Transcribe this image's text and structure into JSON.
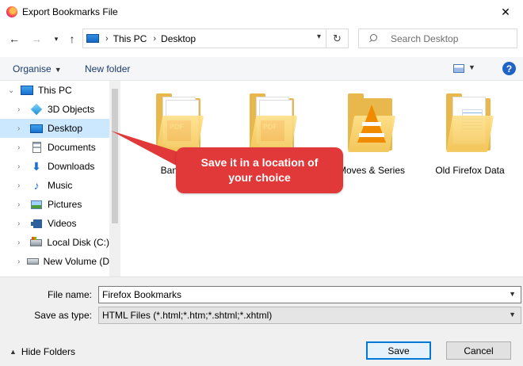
{
  "window": {
    "title": "Export Bookmarks File",
    "close_glyph": "✕"
  },
  "address_bar": {
    "breadcrumb": [
      "This PC",
      "Desktop"
    ],
    "search_placeholder": "Search Desktop"
  },
  "toolbar": {
    "organise_label": "Organise",
    "new_folder_label": "New folder",
    "help_glyph": "?"
  },
  "sidebar": {
    "items": [
      {
        "label": "This PC",
        "icon": "pc-icon"
      },
      {
        "label": "3D Objects",
        "icon": "3d-objects-icon"
      },
      {
        "label": "Desktop",
        "icon": "desktop-icon",
        "selected": true
      },
      {
        "label": "Documents",
        "icon": "documents-icon"
      },
      {
        "label": "Downloads",
        "icon": "downloads-icon"
      },
      {
        "label": "Music",
        "icon": "music-icon"
      },
      {
        "label": "Pictures",
        "icon": "pictures-icon"
      },
      {
        "label": "Videos",
        "icon": "videos-icon"
      },
      {
        "label": "Local Disk (C:)",
        "icon": "local-disk-icon"
      },
      {
        "label": "New Volume (D",
        "icon": "volume-icon"
      }
    ]
  },
  "files": [
    {
      "label": "Bank Sta",
      "kind": "pdf-folder"
    },
    {
      "label": "",
      "kind": "pdf-folder"
    },
    {
      "label": "Moves & Series",
      "kind": "vlc-folder"
    },
    {
      "label": "Old Firefox Data",
      "kind": "doc-folder"
    }
  ],
  "callout": {
    "line1": "Save it in a location of",
    "line2": "your choice",
    "color": "#e1393a"
  },
  "form": {
    "file_name_label": "File name:",
    "file_name_value": "Firefox Bookmarks",
    "save_type_label": "Save as type:",
    "save_type_value": "HTML Files (*.html;*.htm;*.shtml;*.xhtml)"
  },
  "footer": {
    "hide_folders_label": "Hide Folders",
    "save_label": "Save",
    "cancel_label": "Cancel"
  }
}
